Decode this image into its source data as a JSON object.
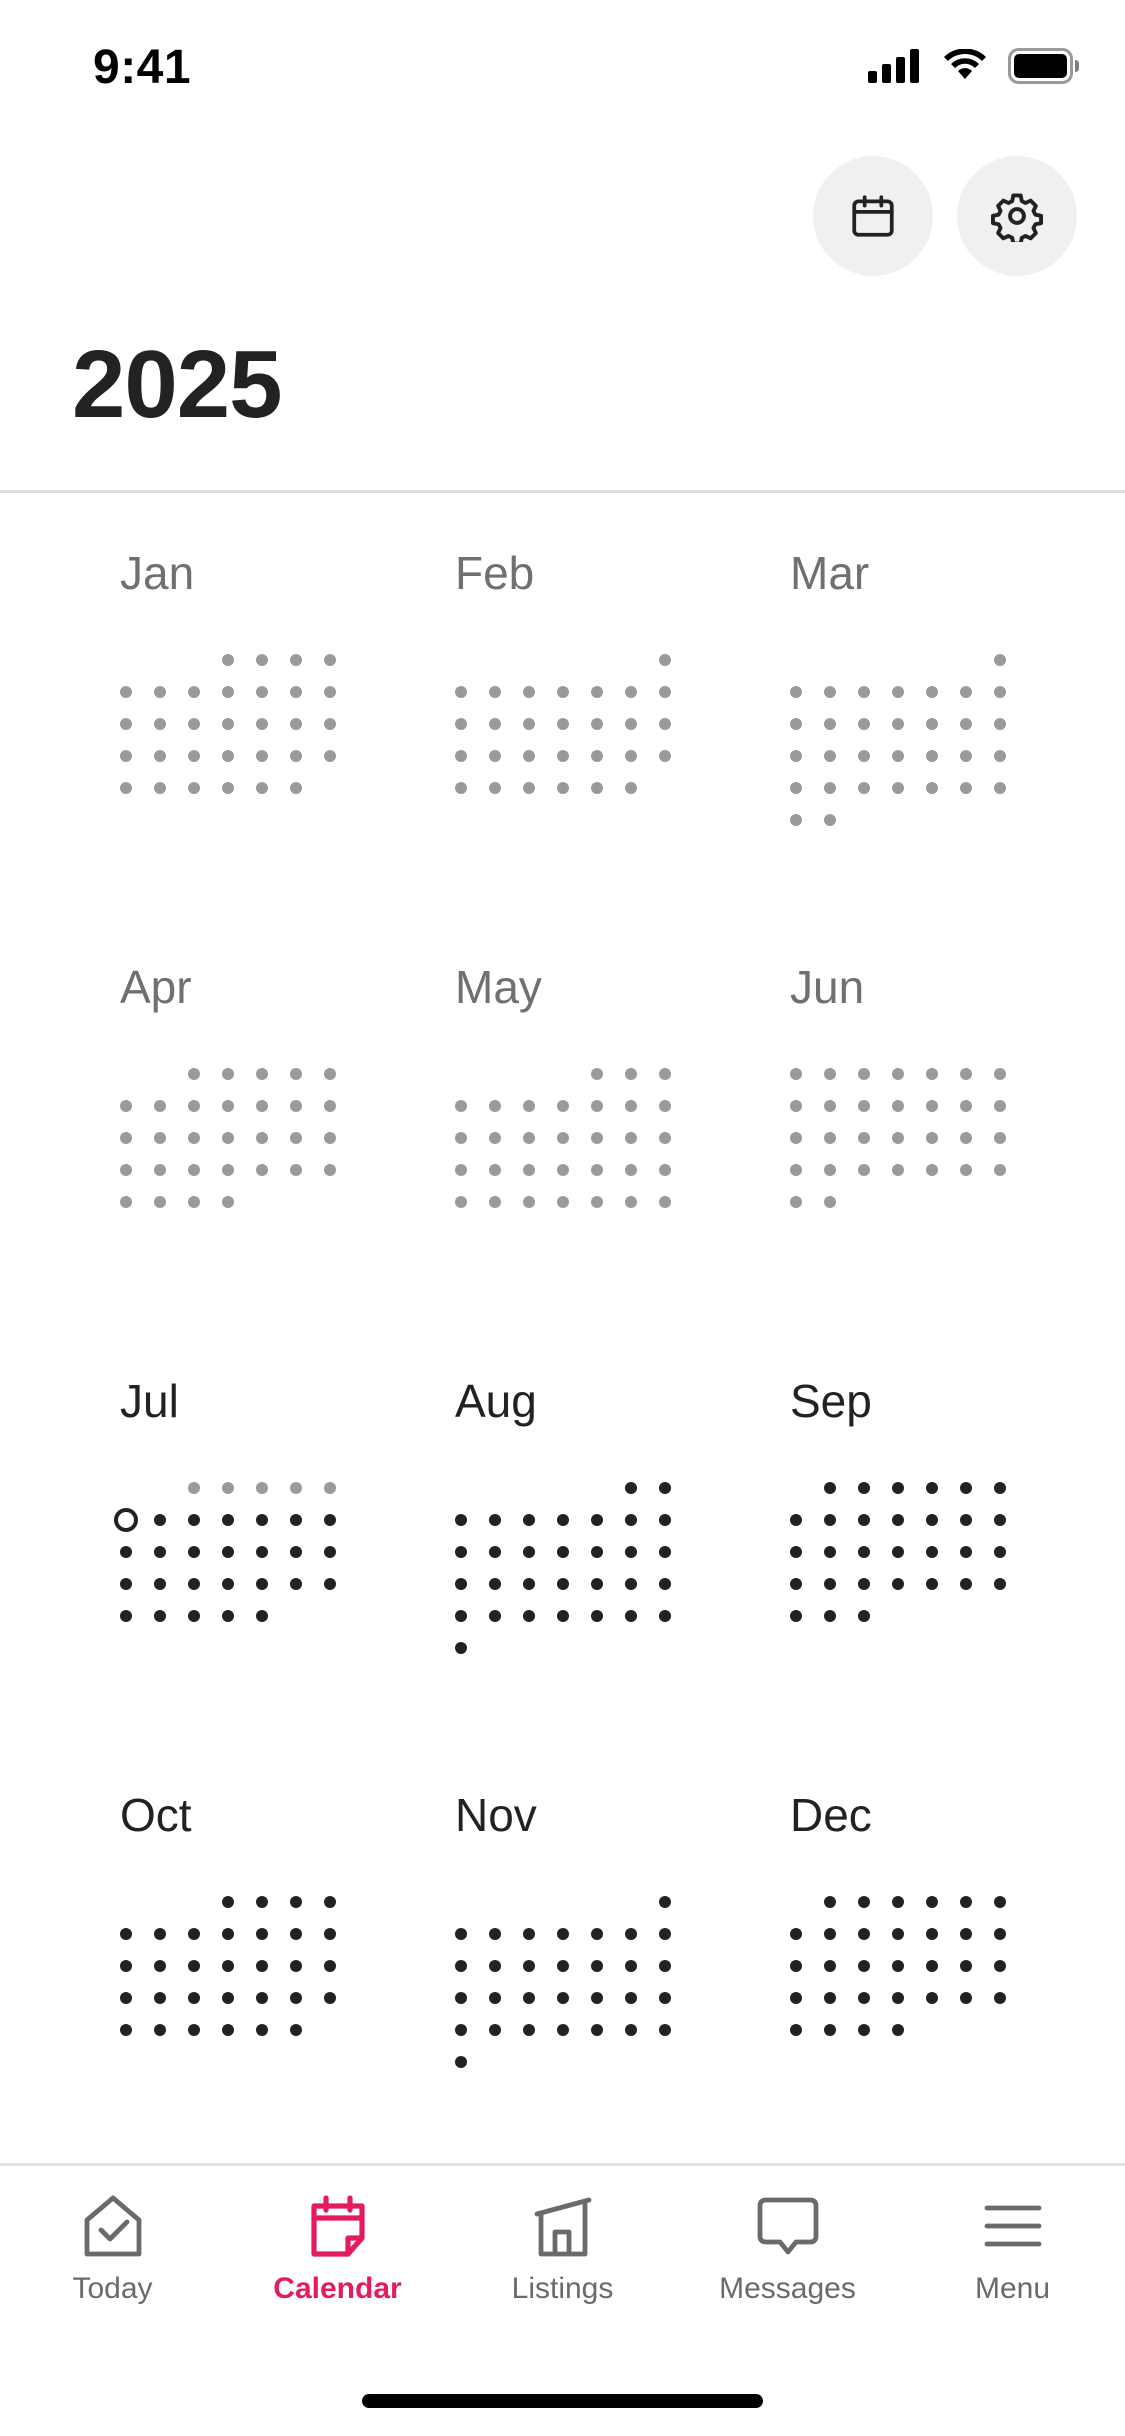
{
  "status_bar": {
    "time": "9:41",
    "icons": [
      "cellular-signal-icon",
      "wifi-icon",
      "battery-icon"
    ]
  },
  "header": {
    "year": "2025",
    "buttons": [
      {
        "icon": "calendar-icon"
      },
      {
        "icon": "gear-icon"
      }
    ]
  },
  "months": [
    {
      "label": "Jan",
      "first_weekday": 3,
      "days": 31,
      "status": "past"
    },
    {
      "label": "Feb",
      "first_weekday": 6,
      "days": 28,
      "status": "past"
    },
    {
      "label": "Mar",
      "first_weekday": 6,
      "days": 31,
      "status": "past"
    },
    {
      "label": "Apr",
      "first_weekday": 2,
      "days": 30,
      "status": "past"
    },
    {
      "label": "May",
      "first_weekday": 4,
      "days": 31,
      "status": "past"
    },
    {
      "label": "Jun",
      "first_weekday": 0,
      "days": 30,
      "status": "past"
    },
    {
      "label": "Jul",
      "first_weekday": 2,
      "days": 31,
      "status": "current",
      "today": 6
    },
    {
      "label": "Aug",
      "first_weekday": 5,
      "days": 31,
      "status": "future"
    },
    {
      "label": "Sep",
      "first_weekday": 1,
      "days": 30,
      "status": "future"
    },
    {
      "label": "Oct",
      "first_weekday": 3,
      "days": 31,
      "status": "future"
    },
    {
      "label": "Nov",
      "first_weekday": 6,
      "days": 30,
      "status": "future"
    },
    {
      "label": "Dec",
      "first_weekday": 1,
      "days": 31,
      "status": "future"
    }
  ],
  "tabs": [
    {
      "label": "Today",
      "icon": "house-check-icon",
      "active": false
    },
    {
      "label": "Calendar",
      "icon": "calendar-icon",
      "active": true
    },
    {
      "label": "Listings",
      "icon": "building-icon",
      "active": false
    },
    {
      "label": "Messages",
      "icon": "chat-bubble-icon",
      "active": false
    },
    {
      "label": "Menu",
      "icon": "hamburger-menu-icon",
      "active": false
    }
  ],
  "colors": {
    "accent": "#E31C5F",
    "past_dot": "#9A9A9A",
    "future_dot": "#222222",
    "text": "#222222",
    "muted": "#707070"
  }
}
